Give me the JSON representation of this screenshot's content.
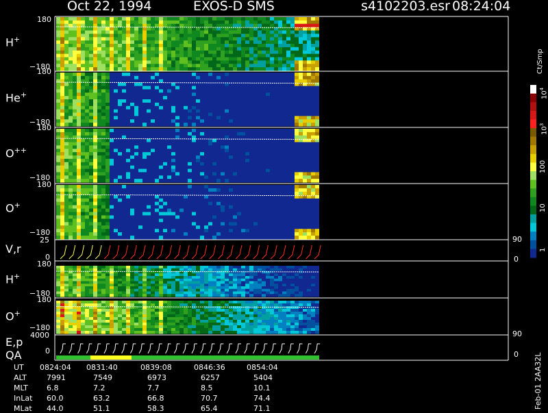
{
  "header": {
    "date": "Oct 22, 1994",
    "mission": "EXOS-D SMS",
    "file": "s4102203.esr",
    "time": "08:24:04"
  },
  "panels": [
    {
      "id": "h_plus_1",
      "species": "H",
      "charge": "+",
      "ymax": "180",
      "ymin": "−180"
    },
    {
      "id": "he_plus",
      "species": "He",
      "charge": "+",
      "ymax": "180",
      "ymin": "−180"
    },
    {
      "id": "o_pp",
      "species": "O",
      "charge": "++",
      "ymax": "180",
      "ymin": "−180"
    },
    {
      "id": "o_plus_1",
      "species": "O",
      "charge": "+",
      "ymax": "180",
      "ymin": "−180"
    },
    {
      "id": "vr",
      "label": "V,r",
      "ymax": "25",
      "ymin": "0",
      "rmax": "90",
      "rmin": "0"
    },
    {
      "id": "h_plus_2",
      "species": "H",
      "charge": "+",
      "ymax": "180",
      "ymin": "−180"
    },
    {
      "id": "o_plus_2",
      "species": "O",
      "charge": "+",
      "ymax": "180",
      "ymin": "−180"
    },
    {
      "id": "ep",
      "label": "E,p",
      "ymax": "4000",
      "ymin": "0",
      "rmax": "90",
      "rmin": "0"
    },
    {
      "id": "qa",
      "label": "QA"
    }
  ],
  "colorbar": {
    "title": "Ct/Smp",
    "ticks": [
      {
        "exp": "10",
        "sup": "4"
      },
      {
        "exp": "10",
        "sup": "3"
      },
      {
        "exp": "100",
        "sup": ""
      },
      {
        "exp": "10",
        "sup": ""
      },
      {
        "exp": "1",
        "sup": ""
      }
    ],
    "colors": [
      "#ffffff",
      "#8b0000",
      "#b01010",
      "#d81818",
      "#ff2020",
      "#7a5a00",
      "#a07800",
      "#c8a000",
      "#e8d000",
      "#ffff40",
      "#a0e060",
      "#60c020",
      "#30a020",
      "#108820",
      "#006818",
      "#00a0a0",
      "#00c8d8",
      "#0080c0",
      "#0050a0",
      "#102890"
    ]
  },
  "chart_data": {
    "type": "heatmap",
    "title": "Oct 22, 1994   EXOS-D SMS",
    "x_ticks": [
      "0824:04",
      "0831:40",
      "0839:08",
      "0846:36",
      "0854:04"
    ],
    "ephemeris": {
      "rows": [
        {
          "name": "UT",
          "values": [
            "0824:04",
            "0831:40",
            "0839:08",
            "0846:36",
            "0854:04"
          ]
        },
        {
          "name": "ALT",
          "values": [
            "7991",
            "7549",
            "6973",
            "6257",
            "5404"
          ]
        },
        {
          "name": "MLT",
          "values": [
            "6.8",
            "7.2",
            "7.7",
            "8.5",
            "10.1"
          ]
        },
        {
          "name": "InLat",
          "values": [
            "60.0",
            "63.2",
            "66.8",
            "70.7",
            "74.4"
          ]
        },
        {
          "name": "MLat",
          "values": [
            "44.0",
            "51.1",
            "58.3",
            "65.4",
            "71.1"
          ]
        }
      ]
    },
    "panels_y_range": [
      -180,
      180
    ],
    "colorbar_range": [
      1,
      10000
    ],
    "colorbar_scale": "log"
  },
  "footer": {
    "stamp": "Feb-01 2AA32L"
  }
}
